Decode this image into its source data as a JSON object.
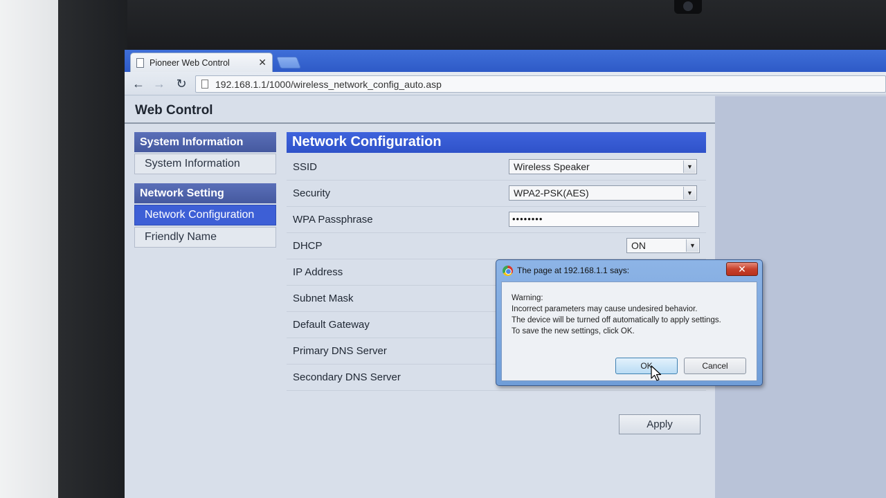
{
  "browser": {
    "tab_title": "Pioneer Web Control",
    "tab_close": "✕",
    "url": "192.168.1.1/1000/wireless_network_config_auto.asp",
    "back_glyph": "←",
    "forward_glyph": "→",
    "reload_glyph": "↻"
  },
  "page": {
    "site_title": "Web Control",
    "sidebar": {
      "groups": [
        {
          "header": "System Information",
          "items": [
            "System Information"
          ]
        },
        {
          "header": "Network Setting",
          "items": [
            "Network Configuration",
            "Friendly Name"
          ]
        }
      ],
      "active_item": "Network Configuration"
    },
    "section_title": "Network Configuration",
    "form": {
      "ssid": {
        "label": "SSID",
        "value": "Wireless Speaker"
      },
      "security": {
        "label": "Security",
        "value": "WPA2-PSK(AES)"
      },
      "passphrase": {
        "label": "WPA Passphrase",
        "value": "••••••••"
      },
      "dhcp": {
        "label": "DHCP",
        "value": "ON"
      },
      "ip": {
        "label": "IP Address"
      },
      "subnet": {
        "label": "Subnet Mask"
      },
      "gateway": {
        "label": "Default Gateway"
      },
      "dns1": {
        "label": "Primary DNS Server"
      },
      "dns2": {
        "label": "Secondary DNS Server"
      }
    },
    "apply_label": "Apply"
  },
  "dialog": {
    "title": "The page at 192.168.1.1 says:",
    "close": "✕",
    "lines": [
      "Warning:",
      "Incorrect parameters may cause undesired behavior.",
      "The device will be turned off automatically to apply settings.",
      "To save the new settings, click OK."
    ],
    "ok_label": "OK",
    "cancel_label": "Cancel"
  },
  "colors": {
    "tabstrip": "#2e5ac7",
    "header_blue": "#3d5fd6",
    "sidebar_header": "#45599f"
  }
}
